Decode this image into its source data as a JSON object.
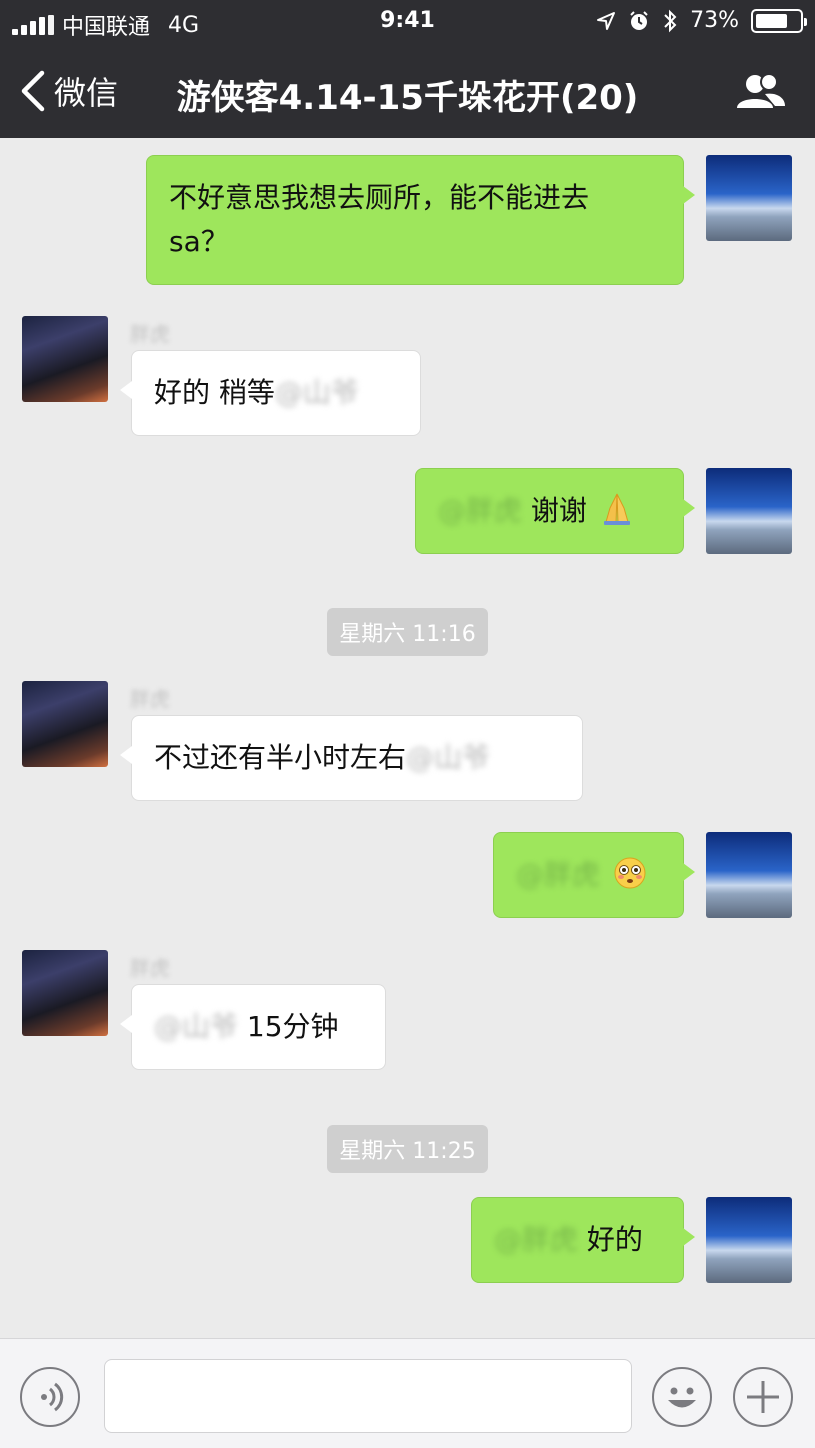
{
  "status_bar": {
    "carrier": "中国联通",
    "network": "4G",
    "time": "9:41",
    "battery": "73%",
    "battery_level": 0.73
  },
  "nav": {
    "back_label": "微信",
    "title": "游侠客4.14-15千垛花开(20)"
  },
  "messages": [
    {
      "from": "me",
      "line1": "不好意思我想去厕所，能不能进去",
      "line2": "sa？"
    },
    {
      "from": "other",
      "sender": "胖虎",
      "text": "好的 稍等",
      "mention": "@山爷"
    },
    {
      "from": "me",
      "mention": "@胖虎",
      "text": " 谢谢",
      "emoji": "folded-hands"
    },
    {
      "timestamp": "星期六 11:16"
    },
    {
      "from": "other",
      "sender": "胖虎",
      "text": "不过还有半小时左右",
      "mention": "@山爷"
    },
    {
      "from": "me",
      "mention": "@胖虎",
      "emoji": "flushed-face"
    },
    {
      "from": "other",
      "sender": "胖虎",
      "mention": "@山爷",
      "text": " 15分钟"
    },
    {
      "timestamp": "星期六 11:25"
    },
    {
      "from": "me",
      "mention": "@胖虎",
      "text": " 好的"
    }
  ],
  "input_bar": {
    "voice_icon": "voice-icon",
    "emoji_icon": "emoji-icon",
    "plus_icon": "plus-icon",
    "placeholder": ""
  },
  "colors": {
    "header": "#2e2e32",
    "chat_bg": "#ebebeb",
    "my_bubble": "#9ee65c",
    "other_bubble": "#ffffff"
  }
}
